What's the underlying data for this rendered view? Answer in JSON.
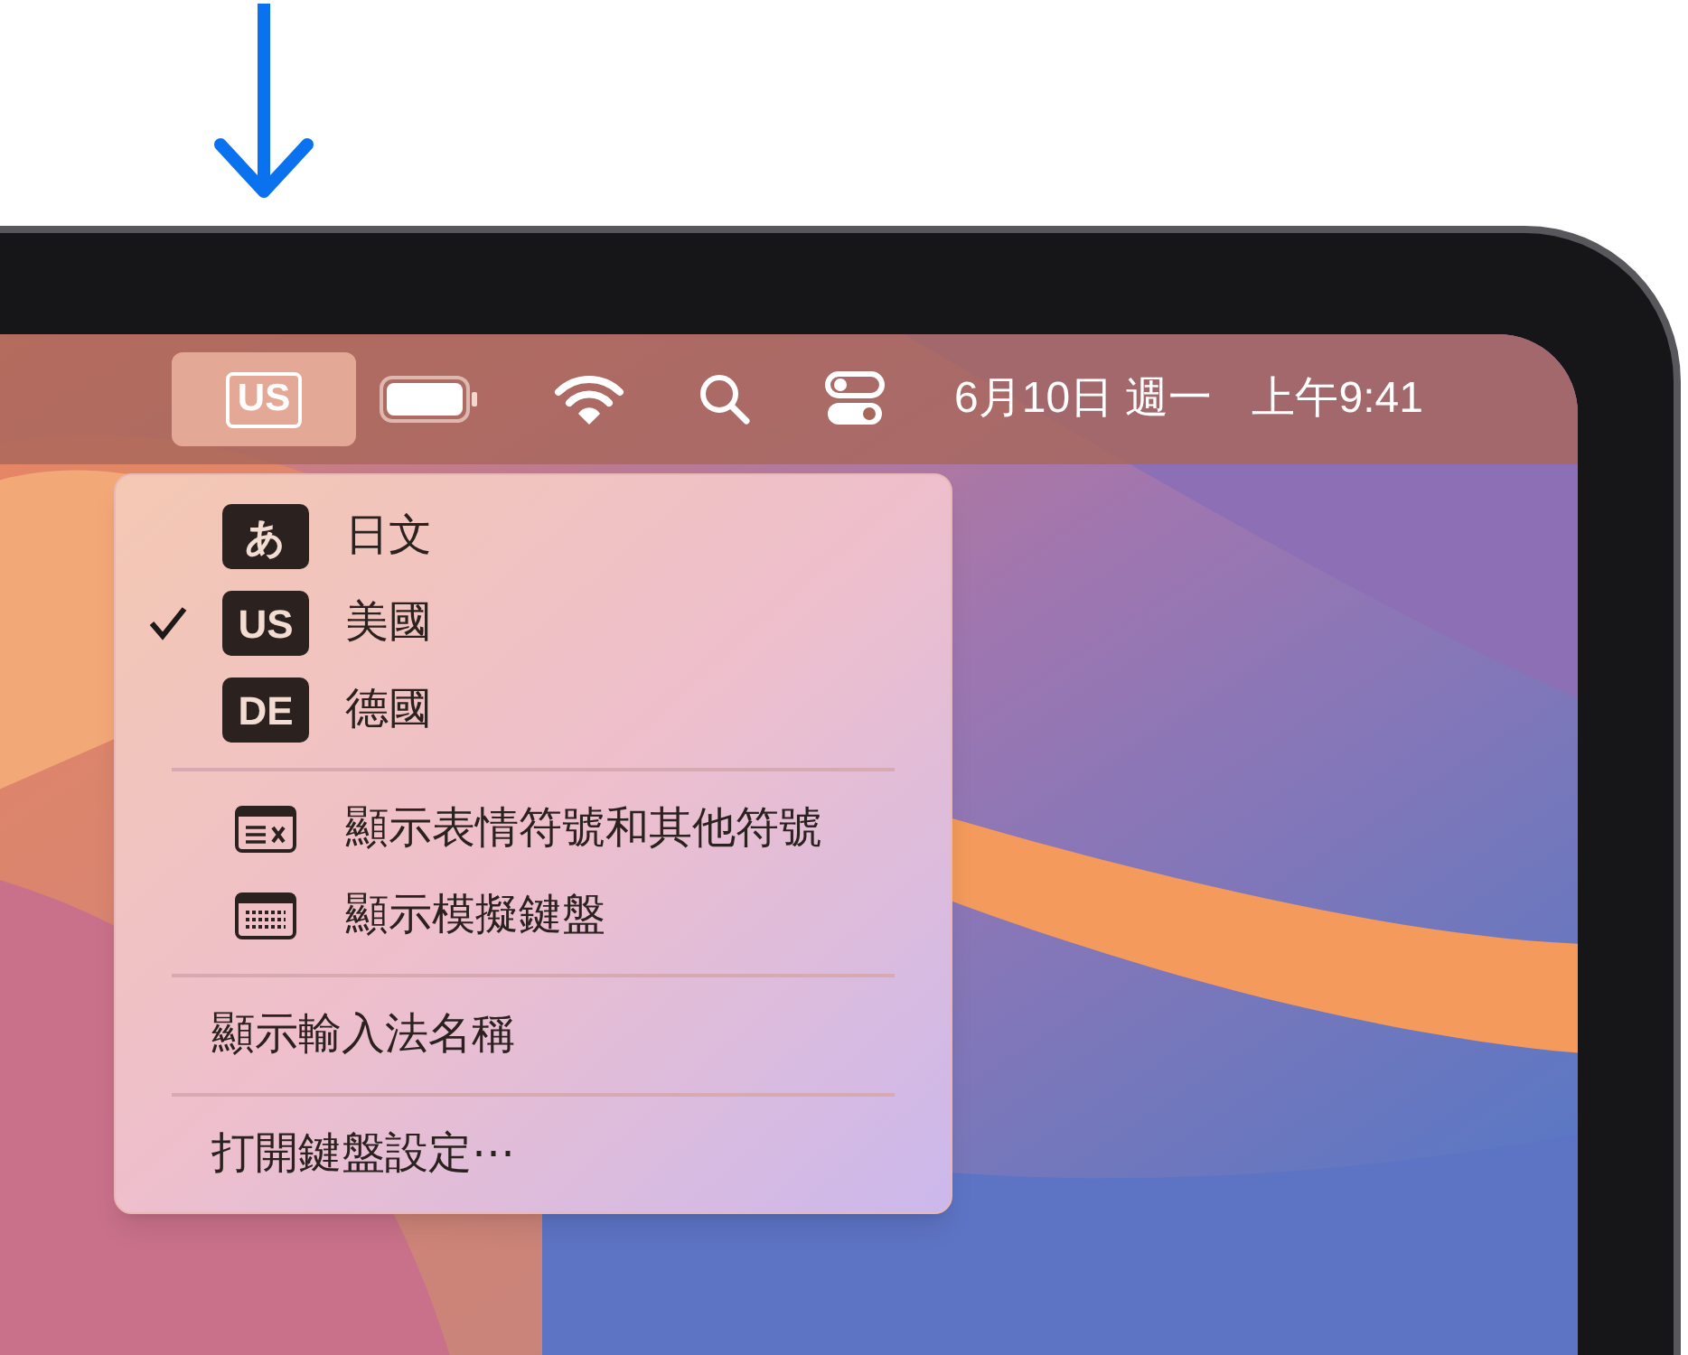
{
  "menu_bar": {
    "input_source": {
      "label": "US",
      "selected": true
    },
    "date": "6月10日 週一",
    "time": "上午9:41"
  },
  "input_menu": {
    "items": [
      {
        "kind": "source",
        "badge": "あ",
        "label": "日文",
        "checked": false
      },
      {
        "kind": "source",
        "badge": "US",
        "label": "美國",
        "checked": true
      },
      {
        "kind": "source",
        "badge": "DE",
        "label": "德國",
        "checked": false
      },
      {
        "kind": "divider"
      },
      {
        "kind": "emoji",
        "label": "顯示表情符號和其他符號"
      },
      {
        "kind": "keyboard",
        "label": "顯示模擬鍵盤"
      },
      {
        "kind": "divider"
      },
      {
        "kind": "action",
        "label": "顯示輸入法名稱"
      },
      {
        "kind": "divider"
      },
      {
        "kind": "action",
        "label": "打開鍵盤設定⋯"
      }
    ]
  }
}
